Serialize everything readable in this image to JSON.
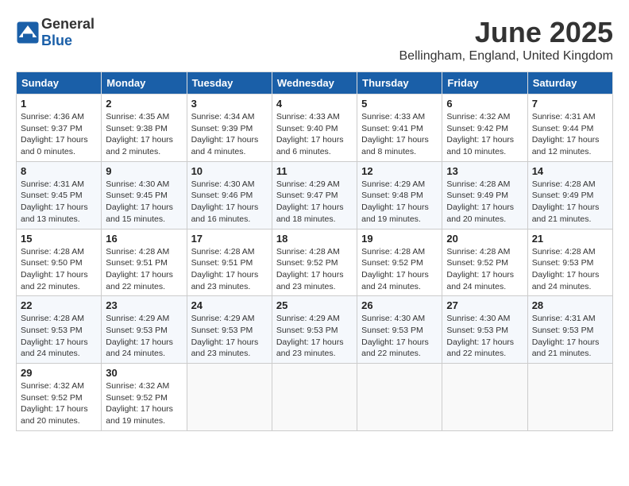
{
  "header": {
    "logo_general": "General",
    "logo_blue": "Blue",
    "month": "June 2025",
    "location": "Bellingham, England, United Kingdom"
  },
  "weekdays": [
    "Sunday",
    "Monday",
    "Tuesday",
    "Wednesday",
    "Thursday",
    "Friday",
    "Saturday"
  ],
  "weeks": [
    [
      {
        "day": "1",
        "sunrise": "4:36 AM",
        "sunset": "9:37 PM",
        "daylight": "17 hours and 0 minutes."
      },
      {
        "day": "2",
        "sunrise": "4:35 AM",
        "sunset": "9:38 PM",
        "daylight": "17 hours and 2 minutes."
      },
      {
        "day": "3",
        "sunrise": "4:34 AM",
        "sunset": "9:39 PM",
        "daylight": "17 hours and 4 minutes."
      },
      {
        "day": "4",
        "sunrise": "4:33 AM",
        "sunset": "9:40 PM",
        "daylight": "17 hours and 6 minutes."
      },
      {
        "day": "5",
        "sunrise": "4:33 AM",
        "sunset": "9:41 PM",
        "daylight": "17 hours and 8 minutes."
      },
      {
        "day": "6",
        "sunrise": "4:32 AM",
        "sunset": "9:42 PM",
        "daylight": "17 hours and 10 minutes."
      },
      {
        "day": "7",
        "sunrise": "4:31 AM",
        "sunset": "9:44 PM",
        "daylight": "17 hours and 12 minutes."
      }
    ],
    [
      {
        "day": "8",
        "sunrise": "4:31 AM",
        "sunset": "9:45 PM",
        "daylight": "17 hours and 13 minutes."
      },
      {
        "day": "9",
        "sunrise": "4:30 AM",
        "sunset": "9:45 PM",
        "daylight": "17 hours and 15 minutes."
      },
      {
        "day": "10",
        "sunrise": "4:30 AM",
        "sunset": "9:46 PM",
        "daylight": "17 hours and 16 minutes."
      },
      {
        "day": "11",
        "sunrise": "4:29 AM",
        "sunset": "9:47 PM",
        "daylight": "17 hours and 18 minutes."
      },
      {
        "day": "12",
        "sunrise": "4:29 AM",
        "sunset": "9:48 PM",
        "daylight": "17 hours and 19 minutes."
      },
      {
        "day": "13",
        "sunrise": "4:28 AM",
        "sunset": "9:49 PM",
        "daylight": "17 hours and 20 minutes."
      },
      {
        "day": "14",
        "sunrise": "4:28 AM",
        "sunset": "9:49 PM",
        "daylight": "17 hours and 21 minutes."
      }
    ],
    [
      {
        "day": "15",
        "sunrise": "4:28 AM",
        "sunset": "9:50 PM",
        "daylight": "17 hours and 22 minutes."
      },
      {
        "day": "16",
        "sunrise": "4:28 AM",
        "sunset": "9:51 PM",
        "daylight": "17 hours and 22 minutes."
      },
      {
        "day": "17",
        "sunrise": "4:28 AM",
        "sunset": "9:51 PM",
        "daylight": "17 hours and 23 minutes."
      },
      {
        "day": "18",
        "sunrise": "4:28 AM",
        "sunset": "9:52 PM",
        "daylight": "17 hours and 23 minutes."
      },
      {
        "day": "19",
        "sunrise": "4:28 AM",
        "sunset": "9:52 PM",
        "daylight": "17 hours and 24 minutes."
      },
      {
        "day": "20",
        "sunrise": "4:28 AM",
        "sunset": "9:52 PM",
        "daylight": "17 hours and 24 minutes."
      },
      {
        "day": "21",
        "sunrise": "4:28 AM",
        "sunset": "9:53 PM",
        "daylight": "17 hours and 24 minutes."
      }
    ],
    [
      {
        "day": "22",
        "sunrise": "4:28 AM",
        "sunset": "9:53 PM",
        "daylight": "17 hours and 24 minutes."
      },
      {
        "day": "23",
        "sunrise": "4:29 AM",
        "sunset": "9:53 PM",
        "daylight": "17 hours and 24 minutes."
      },
      {
        "day": "24",
        "sunrise": "4:29 AM",
        "sunset": "9:53 PM",
        "daylight": "17 hours and 23 minutes."
      },
      {
        "day": "25",
        "sunrise": "4:29 AM",
        "sunset": "9:53 PM",
        "daylight": "17 hours and 23 minutes."
      },
      {
        "day": "26",
        "sunrise": "4:30 AM",
        "sunset": "9:53 PM",
        "daylight": "17 hours and 22 minutes."
      },
      {
        "day": "27",
        "sunrise": "4:30 AM",
        "sunset": "9:53 PM",
        "daylight": "17 hours and 22 minutes."
      },
      {
        "day": "28",
        "sunrise": "4:31 AM",
        "sunset": "9:53 PM",
        "daylight": "17 hours and 21 minutes."
      }
    ],
    [
      {
        "day": "29",
        "sunrise": "4:32 AM",
        "sunset": "9:52 PM",
        "daylight": "17 hours and 20 minutes."
      },
      {
        "day": "30",
        "sunrise": "4:32 AM",
        "sunset": "9:52 PM",
        "daylight": "17 hours and 19 minutes."
      },
      null,
      null,
      null,
      null,
      null
    ]
  ]
}
